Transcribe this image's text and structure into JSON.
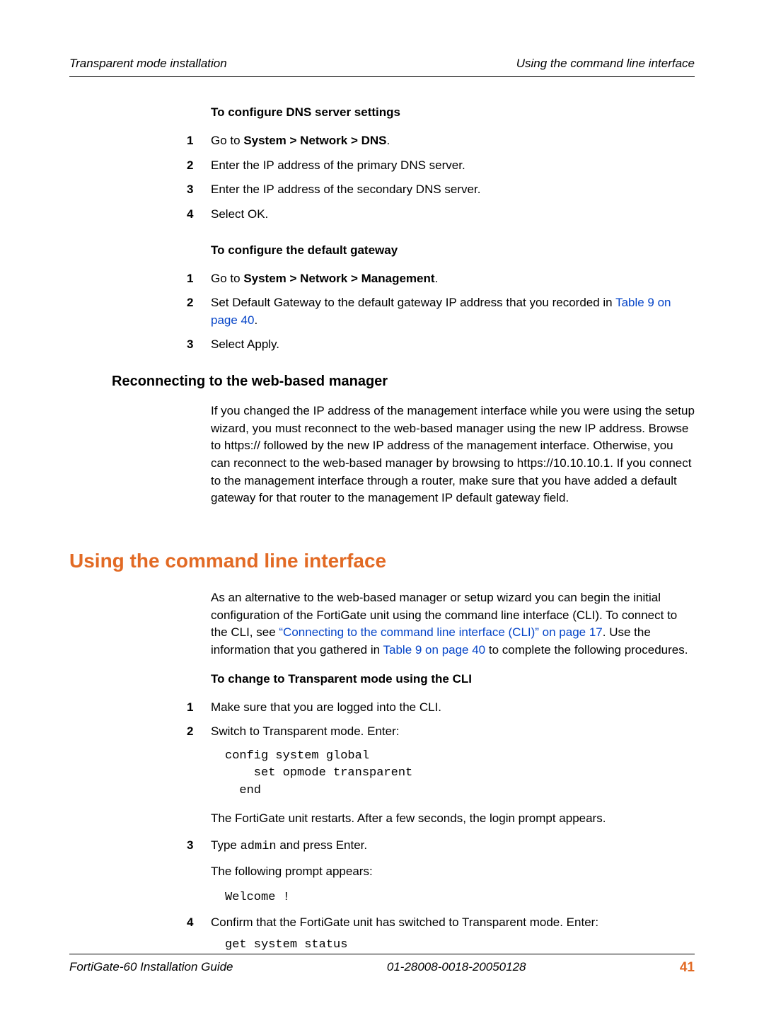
{
  "header": {
    "left": "Transparent mode installation",
    "right": "Using the command line interface"
  },
  "dns": {
    "heading": "To configure DNS server settings",
    "steps": {
      "s1_prefix": "Go to ",
      "s1_bold": "System > Network > DNS",
      "s1_suffix": ".",
      "s2": "Enter the IP address of the primary DNS server.",
      "s3": "Enter the IP address of the secondary DNS server.",
      "s4": "Select OK."
    }
  },
  "gateway": {
    "heading": "To configure the default gateway",
    "steps": {
      "s1_prefix": "Go to ",
      "s1_bold": "System > Network > Management",
      "s1_suffix": ".",
      "s2_a": "Set Default Gateway to the default gateway IP address that you recorded in ",
      "s2_link": "Table 9 on page 40",
      "s2_b": ".",
      "s3": "Select Apply."
    }
  },
  "reconnect": {
    "heading": "Reconnecting to the web-based manager",
    "para": "If you changed the IP address of the management interface while you were using the setup wizard, you must reconnect to the web-based manager using the new IP address. Browse to https:// followed by the new IP address of the management interface. Otherwise, you can reconnect to the web-based manager by browsing to https://10.10.10.1. If you connect to the management interface through a router, make sure that you have added a default gateway for that router to the management IP default gateway field."
  },
  "cli": {
    "heading": "Using the command line interface",
    "intro_a": "As an alternative to the web-based manager or setup wizard you can begin the initial configuration of the FortiGate unit using the command line interface (CLI). To connect to the CLI, see ",
    "intro_link1": "“Connecting to the command line interface (CLI)” on page 17",
    "intro_b": ". Use the information that you gathered in ",
    "intro_link2": "Table 9 on page 40",
    "intro_c": " to complete the following procedures.",
    "change_heading": "To change to Transparent mode using the CLI",
    "steps": {
      "s1": "Make sure that you are logged into the CLI.",
      "s2": "Switch to Transparent mode. Enter:",
      "code1": "config system global\n    set opmode transparent\n  end",
      "after2": "The FortiGate unit restarts. After a few seconds, the login prompt appears.",
      "s3_a": "Type ",
      "s3_code": "admin",
      "s3_b": " and press Enter.",
      "after3": "The following prompt appears:",
      "code2": "Welcome !",
      "s4": "Confirm that the FortiGate unit has switched to Transparent mode. Enter:",
      "code3": "get system status"
    }
  },
  "footer": {
    "left": "FortiGate-60 Installation Guide",
    "center": "01-28008-0018-20050128",
    "page": "41"
  }
}
